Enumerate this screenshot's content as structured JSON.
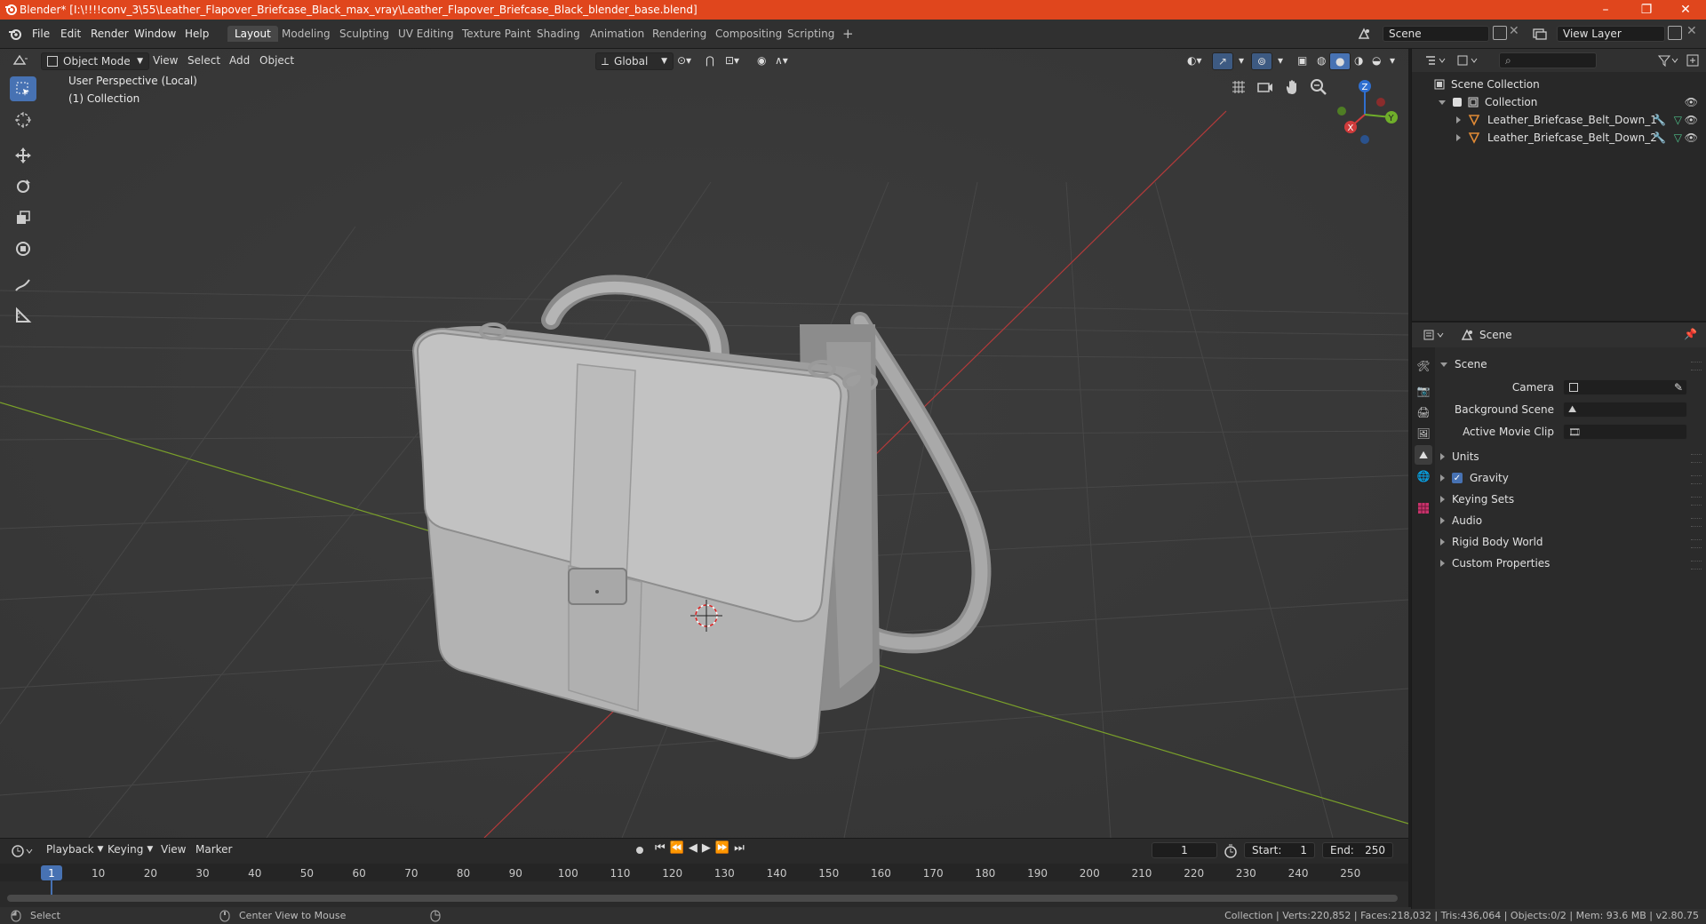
{
  "window": {
    "title": "Blender* [I:\\!!!!conv_3\\55\\Leather_Flapover_Briefcase_Black_max_vray\\Leather_Flapover_Briefcase_Black_blender_base.blend]",
    "minimize": "–",
    "maximize": "❐",
    "close": "✕"
  },
  "menu": [
    "File",
    "Edit",
    "Render",
    "Window",
    "Help"
  ],
  "workspaces": [
    "Layout",
    "Modeling",
    "Sculpting",
    "UV Editing",
    "Texture Paint",
    "Shading",
    "Animation",
    "Rendering",
    "Compositing",
    "Scripting"
  ],
  "workspace_add": "+",
  "scene_field": "Scene",
  "view_layer_field": "View Layer",
  "viewport": {
    "mode": "Object Mode",
    "menus": [
      "View",
      "Select",
      "Add",
      "Object"
    ],
    "transform_orientation": "Global",
    "perspective_label": "User Perspective (Local)",
    "collection_label": "(1) Collection",
    "gizmo_axes": {
      "x": "X",
      "y": "Y",
      "z": "Z"
    },
    "colors": {
      "bg": "#393939",
      "grid": "#444444",
      "x_axis": "#b33a3a",
      "y_axis": "#7aa02a",
      "selection": "#4772b3"
    }
  },
  "timeline": {
    "menus": [
      "Playback",
      "Keying",
      "View",
      "Marker"
    ],
    "current_frame": "1",
    "start_label": "Start:",
    "start_value": "1",
    "end_label": "End:",
    "end_value": "250",
    "frame_badge": "1",
    "ticks": [
      "10",
      "20",
      "30",
      "40",
      "50",
      "60",
      "70",
      "80",
      "90",
      "100",
      "110",
      "120",
      "130",
      "140",
      "150",
      "160",
      "170",
      "180",
      "190",
      "200",
      "210",
      "220",
      "230",
      "240",
      "250"
    ]
  },
  "statusbar": {
    "select": "Select",
    "center_view": "Center View to Mouse",
    "stats": "Collection | Verts:220,852 | Faces:218,032 | Tris:436,064 | Objects:0/2 | Mem: 93.6 MB | v2.80.75"
  },
  "outliner": {
    "scene_collection": "Scene Collection",
    "collection": "Collection",
    "objects": [
      "Leather_Briefcase_Belt_Down_1",
      "Leather_Briefcase_Belt_Down_2"
    ]
  },
  "properties": {
    "header": "Scene",
    "panel": "Scene",
    "camera_label": "Camera",
    "background_scene_label": "Background Scene",
    "active_movie_clip_label": "Active Movie Clip",
    "sections": [
      "Units",
      "Gravity",
      "Keying Sets",
      "Audio",
      "Rigid Body World",
      "Custom Properties"
    ],
    "gravity_checked": true
  }
}
